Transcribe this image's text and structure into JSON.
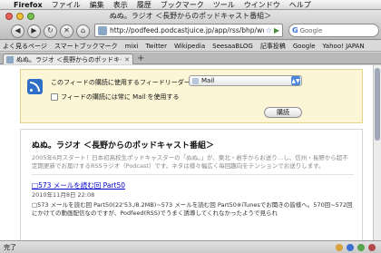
{
  "menubar": {
    "app": "Firefox",
    "items": [
      "ファイル",
      "編集",
      "表示",
      "履歴",
      "ブックマーク",
      "ツール",
      "ウインドウ",
      "ヘルプ"
    ]
  },
  "window": {
    "title": "ぬぬ。ラジオ ＜長野からのポッドキャスト番組＞"
  },
  "toolbar": {
    "back_glyph": "◀",
    "forward_glyph": "▶",
    "reload_glyph": "↻",
    "stop_glyph": "✕",
    "home_glyph": "⌂",
    "url": "http://podfeed.podcastjuice.jp/app/rss/bhp/wwv",
    "search_engine_glyph": "G",
    "search_placeholder": "Google"
  },
  "bookmarks": [
    "よく見るページ",
    "スマートブックマーク",
    "mixi",
    "Twitter",
    "Wikipedia",
    "SeesaaBLOG",
    "記事投稿",
    "Google",
    "Yahoo! JAPAN"
  ],
  "tab": {
    "label": "ぬぬ。ラジオ ＜長野からのポッドキャ...",
    "close_glyph": "✕",
    "new_tab_glyph": "+"
  },
  "feed_prompt": {
    "reader_label": "このフィードの購読に使用するフィードリーダー:",
    "reader_value": "Mail",
    "always_label": "フィードの購読には常に Mail を使用する",
    "subscribe_label": "購読"
  },
  "feed": {
    "title": "ぬぬ。ラジオ ＜長野からのポッドキャスト番組＞",
    "description": "2005年6月スタート！日本初高校生ポッドキャスターの「ぬぬ。」が、東北・岩手からお送り…し、信州・長野から超不定期更新でお届けするRSSラジオ（Podcast）です。ネタは様々幅広く毎回趣向をテンションでお送りします。",
    "entry_title": "□573 メールを読む回 Part50",
    "entry_date": "2010年11月8日 22:08",
    "entry_body": "□573 メールを読む回 Part50(22'53./8.2MB)~573 メールを読む回 Part50※iTunesでお聞きの皆様へ。570回~572回にかけての動画配信なのですが、Podfeed(RSS)でうまく誘導してくれなかったようで見られ"
  },
  "status": {
    "text": "完了"
  },
  "colors": {
    "accent": "#2f6fc7",
    "feedbox_bg": "#fcf6d6",
    "link": "#0000cc"
  }
}
